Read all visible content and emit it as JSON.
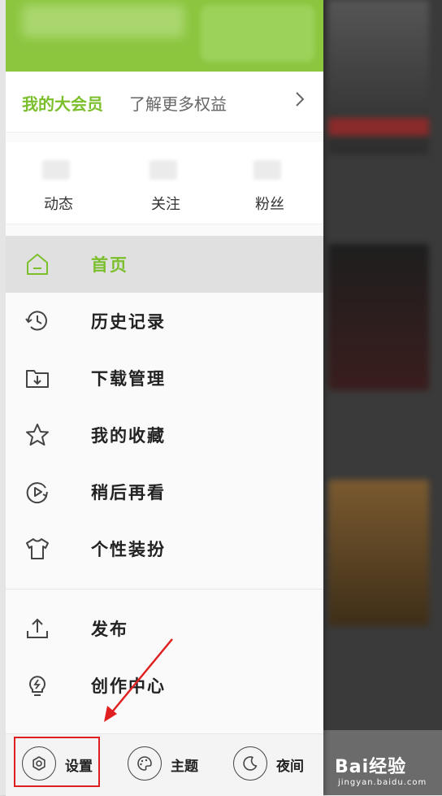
{
  "member": {
    "title": "我的大会员",
    "subtitle": "了解更多权益"
  },
  "stats": [
    {
      "label": "动态"
    },
    {
      "label": "关注"
    },
    {
      "label": "粉丝"
    }
  ],
  "menu": {
    "group1": [
      {
        "label": "首页",
        "icon": "home-icon",
        "active": true
      },
      {
        "label": "历史记录",
        "icon": "history-icon"
      },
      {
        "label": "下载管理",
        "icon": "download-folder-icon"
      },
      {
        "label": "我的收藏",
        "icon": "star-icon"
      },
      {
        "label": "稍后再看",
        "icon": "watch-later-icon"
      },
      {
        "label": "个性装扮",
        "icon": "tshirt-icon"
      }
    ],
    "group2": [
      {
        "label": "发布",
        "icon": "upload-icon"
      },
      {
        "label": "创作中心",
        "icon": "bulb-icon"
      }
    ]
  },
  "bottom": {
    "settings": "设置",
    "theme": "主题",
    "night": "夜间"
  },
  "watermark": {
    "brand": "Bai",
    "brand2": "经验",
    "url": "jingyan.baidu.com"
  },
  "colors": {
    "accent": "#8cc63f",
    "highlight": "#e02020"
  }
}
